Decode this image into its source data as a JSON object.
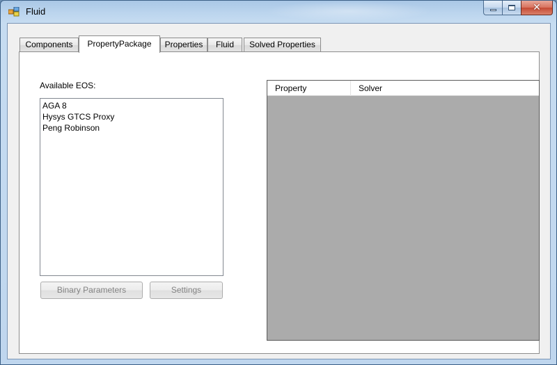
{
  "window": {
    "title": "Fluid",
    "caption": {
      "minimize": "",
      "maximize": "",
      "close": "✕"
    }
  },
  "tabs": [
    {
      "label": "Components"
    },
    {
      "label": "PropertyPackage"
    },
    {
      "label": "Properties"
    },
    {
      "label": "Fluid"
    },
    {
      "label": "Solved Properties"
    }
  ],
  "active_tab": "PropertyPackage",
  "eos": {
    "label": "Available EOS:",
    "items": [
      "AGA 8",
      "Hysys GTCS Proxy",
      "Peng Robinson"
    ]
  },
  "buttons": {
    "binary_parameters": "Binary Parameters",
    "settings": "Settings"
  },
  "grid": {
    "columns": [
      "Property",
      "Solver"
    ]
  },
  "colors": {
    "grid_background": "#ababab",
    "close_button": "#c54a34",
    "disabled_text": "#838383"
  },
  "icons": {
    "app": "app-window-icon",
    "minimize": "minimize-icon",
    "maximize": "maximize-icon",
    "close": "close-icon"
  }
}
